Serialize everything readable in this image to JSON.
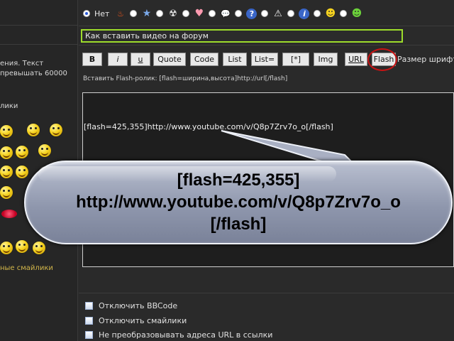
{
  "left": {
    "text_line1": "ения. Текст",
    "text_line2": "превышать 60000",
    "smilies_heading": "лики",
    "more_smilies_link": "ные смайлики"
  },
  "post_icons": {
    "none_label": "Нет",
    "icons": [
      "fire-icon",
      "star-icon",
      "radioactive-icon",
      "heart-icon",
      "speech-bubble-icon",
      "question-icon",
      "warning-icon",
      "info-icon",
      "lightbulb-smiley-icon",
      "grin-smiley-icon"
    ]
  },
  "subject": {
    "value": "Как вставить видео на форум"
  },
  "toolbar": {
    "bold": "B",
    "italic": "i",
    "underline": "u",
    "quote": "Quote",
    "code": "Code",
    "list": "List",
    "list_numbered": "List=",
    "list_item": "[*]",
    "img": "Img",
    "url": "URL",
    "flash": "Flash",
    "font_size": "Размер шрифта"
  },
  "helpline": "Вставить Flash-ролик: [flash=ширина,высота]http://url[/flash]",
  "message": {
    "content": "[flash=425,355]http://www.youtube.com/v/Q8p7Zrv7o_o[/flash]"
  },
  "callout": {
    "line1": "[flash=425,355]",
    "line2": "http://www.youtube.com/v/Q8p7Zrv7o_o",
    "line3": "[/flash]"
  },
  "options": {
    "disable_bbcode": "Отключить BBCode",
    "disable_smilies": "Отключить смайлики",
    "no_url_parse": "Не преобразовывать адреса URL в ссылки"
  },
  "colors": {
    "subject_border": "#9ddc2b",
    "flash_highlight": "#c81414",
    "more_smilies_link": "#d2b64a"
  }
}
